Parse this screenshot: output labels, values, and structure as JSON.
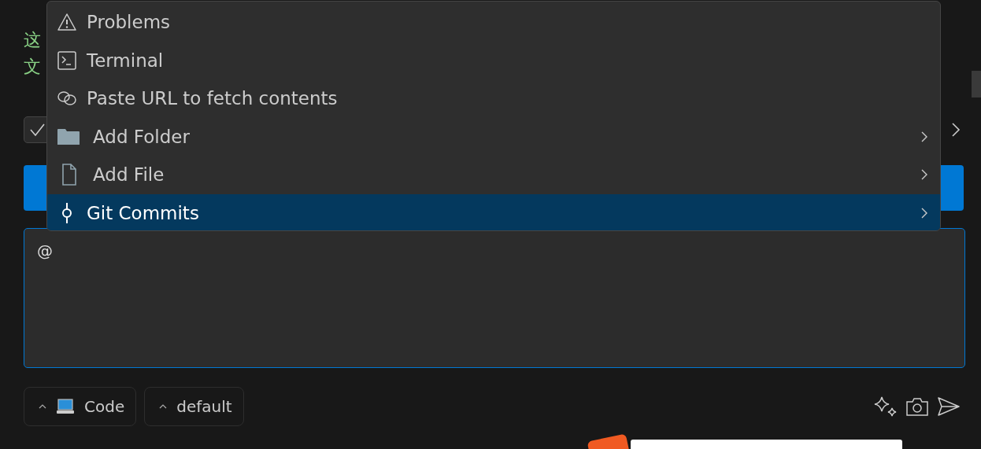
{
  "message": {
    "line_1_start": "这",
    "line_2_start": "文"
  },
  "checkbox": {
    "checked": true
  },
  "input": {
    "value": "@"
  },
  "mode_buttons": [
    {
      "label": "Code",
      "kind": "laptop"
    },
    {
      "label": "default",
      "kind": "plain"
    }
  ],
  "menu": {
    "items": [
      {
        "label": "Problems",
        "kind": "warning",
        "submenu": false,
        "selected": false
      },
      {
        "label": "Terminal",
        "kind": "terminal",
        "submenu": false,
        "selected": false
      },
      {
        "label": "Paste URL to fetch contents",
        "kind": "link",
        "submenu": false,
        "selected": false
      },
      {
        "label": "Add Folder",
        "kind": "folder",
        "submenu": true,
        "selected": false
      },
      {
        "label": "Add File",
        "kind": "file",
        "submenu": true,
        "selected": false
      },
      {
        "label": "Git Commits",
        "kind": "commit",
        "submenu": true,
        "selected": true
      }
    ]
  }
}
